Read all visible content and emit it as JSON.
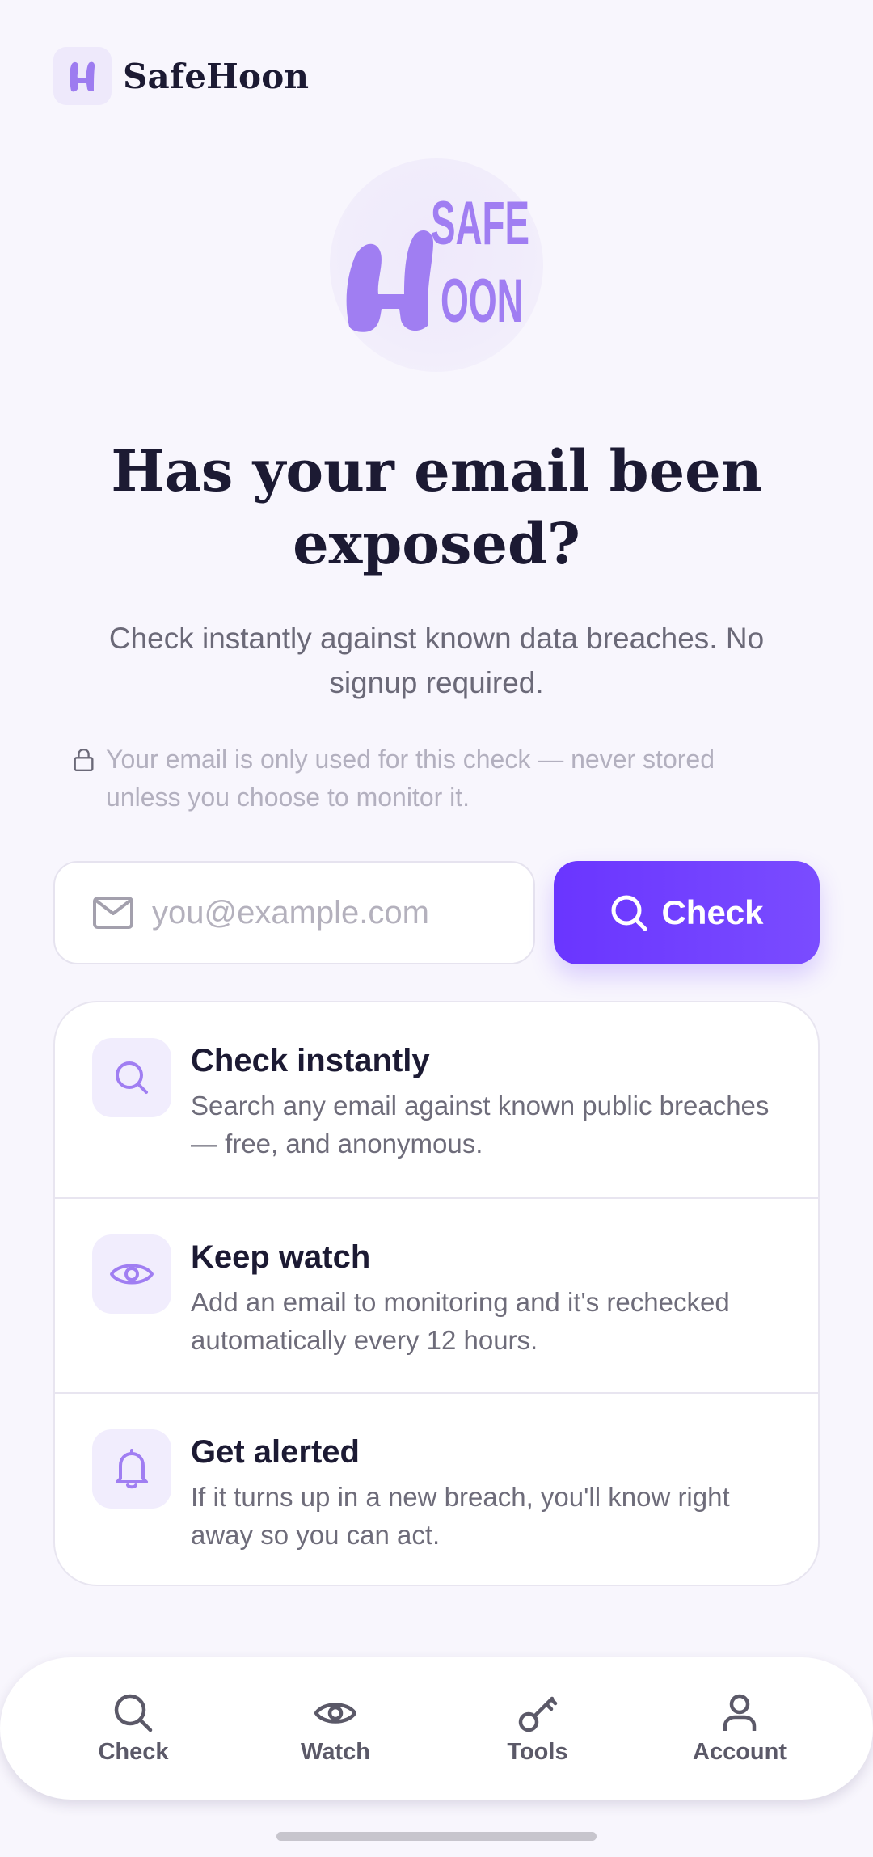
{
  "app": {
    "brand_name": "SafeHoon",
    "logo_text_top": "SAFE",
    "logo_text_bottom": "OON"
  },
  "hero": {
    "title": "Has your email been exposed?",
    "subtitle": "Check instantly against known data breaches. No signup required.",
    "privacy_note": "Your email is only used for this check — never stored unless you choose to monitor it."
  },
  "search": {
    "placeholder": "you@example.com",
    "value": "",
    "button_label": "Check"
  },
  "features": [
    {
      "icon": "search-icon",
      "title": "Check instantly",
      "description": "Search any email against known public breaches — free, and anonymous."
    },
    {
      "icon": "eye-icon",
      "title": "Keep watch",
      "description": "Add an email to monitoring and it's rechecked automatically every 12 hours."
    },
    {
      "icon": "bell-icon",
      "title": "Get alerted",
      "description": "If it turns up in a new breach, you'll know right away so you can act."
    }
  ],
  "bottom_nav": [
    {
      "label": "Check",
      "icon": "search-icon"
    },
    {
      "label": "Watch",
      "icon": "eye-icon"
    },
    {
      "label": "Tools",
      "icon": "key-icon"
    },
    {
      "label": "Account",
      "icon": "user-icon"
    }
  ],
  "colors": {
    "accent": "#6a35ff",
    "logo_purple": "#9d7cf0",
    "background": "#f8f6fd"
  }
}
